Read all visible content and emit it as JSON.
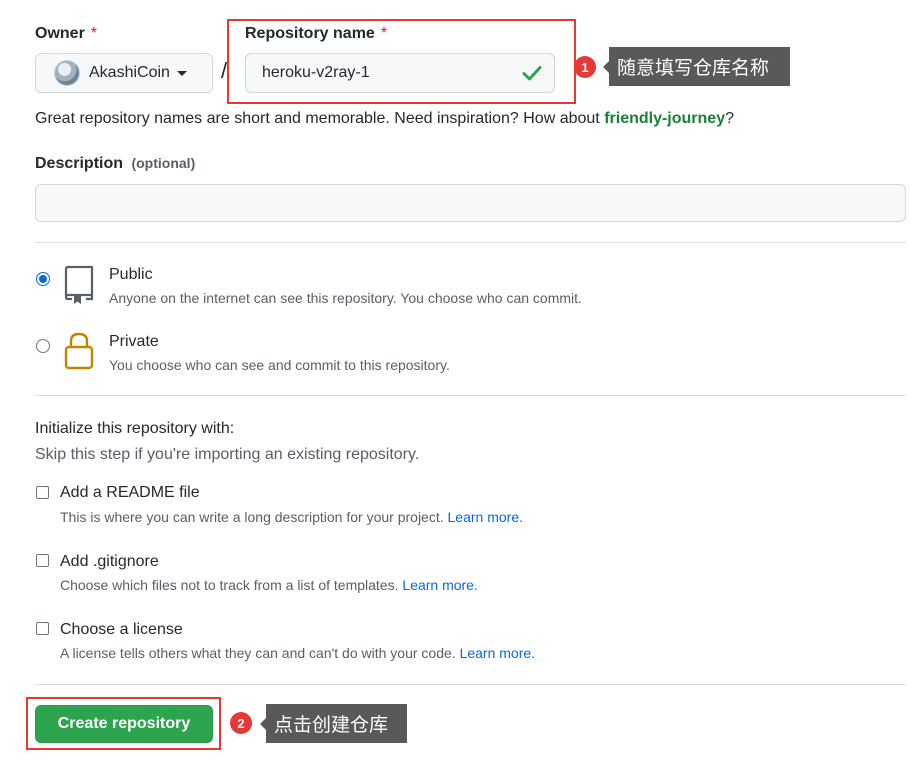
{
  "owner": {
    "label": "Owner",
    "required_mark": "*",
    "value": "AkashiCoin"
  },
  "separator": "/",
  "repository": {
    "label": "Repository name",
    "required_mark": "*",
    "value": "heroku-v2ray-1"
  },
  "hint": {
    "text": "Great repository names are short and memorable. Need inspiration? How about ",
    "suggestion": "friendly-journey",
    "suffix": "?"
  },
  "description": {
    "label": "Description",
    "optional": "(optional)",
    "value": ""
  },
  "visibility": {
    "public": {
      "label": "Public",
      "desc": "Anyone on the internet can see this repository. You choose who can commit.",
      "selected": true
    },
    "private": {
      "label": "Private",
      "desc": "You choose who can see and commit to this repository.",
      "selected": false
    }
  },
  "init": {
    "title": "Initialize this repository with:",
    "subtitle": "Skip this step if you're importing an existing repository.",
    "readme": {
      "label": "Add a README file",
      "desc": "This is where you can write a long description for your project.",
      "link": "Learn more."
    },
    "gitignore": {
      "label": "Add .gitignore",
      "desc": "Choose which files not to track from a list of templates.",
      "link": "Learn more."
    },
    "license": {
      "label": "Choose a license",
      "desc": "A license tells others what they can and can't do with your code.",
      "link": "Learn more."
    }
  },
  "create_button": "Create repository",
  "annotations": {
    "one": {
      "number": "1",
      "text": "随意填写仓库名称"
    },
    "two": {
      "number": "2",
      "text": "点击创建仓库"
    }
  },
  "colors": {
    "accent_blue": "#0969da",
    "success_green": "#2da44e",
    "highlight_red": "#e53935",
    "tooltip_gray": "#595959"
  }
}
